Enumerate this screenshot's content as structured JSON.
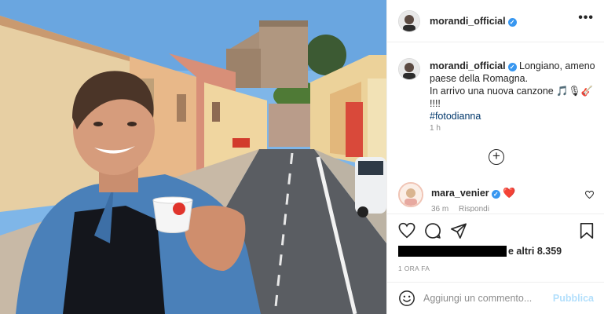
{
  "post": {
    "username": "morandi_official",
    "verified_badge": "✓",
    "more_label": "•••"
  },
  "caption": {
    "username": "morandi_official",
    "line1": "Longiano, ameno paese della Romagna.",
    "line2": "In arrivo una nuova canzone 🎵🎙🎸 !!!!",
    "hashtag": "#fotodianna",
    "age": "1 h"
  },
  "load_more_label": "+",
  "comment": {
    "username": "mara_venier",
    "text": "❤️",
    "age": "36 m",
    "reply_label": "Rispondi"
  },
  "likes": {
    "redacted": true,
    "tail_text": "e altri 8.359"
  },
  "post_time": "1 ORA FA",
  "add_comment": {
    "placeholder": "Aggiungi un commento...",
    "publish_label": "Pubblica"
  },
  "icons": {
    "like": "heart-icon",
    "comment": "comment-bubble-icon",
    "share": "paper-plane-icon",
    "save": "bookmark-icon",
    "emoji": "smiley-icon",
    "more": "ellipsis-icon"
  },
  "colors": {
    "verified": "#3897f0",
    "hashtag": "#00376b",
    "publish": "#b2dffc",
    "meta": "#8e8e8e"
  }
}
